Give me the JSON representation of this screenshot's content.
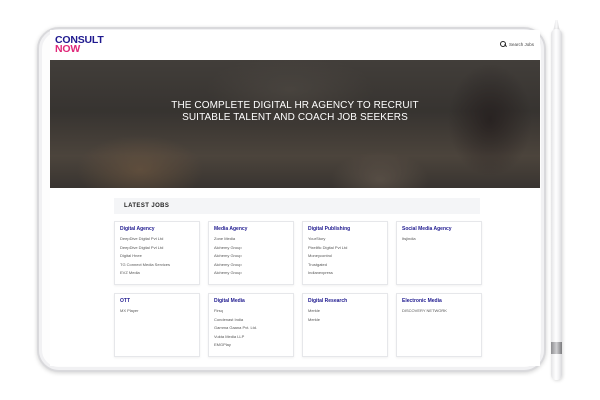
{
  "header": {
    "logo_line1": "CONSULT",
    "logo_line2": "NOW",
    "search_label": "Search Jobs"
  },
  "hero": {
    "title": "THE COMPLETE DIGITAL HR AGENCY TO RECRUIT SUITABLE TALENT AND COACH JOB SEEKERS"
  },
  "jobs": {
    "section_title": "LATEST JOBS",
    "categories": [
      {
        "title": "Digital Agency",
        "items": [
          "DeepDive Digital Pvt Ltd",
          "DeepDive Digital Pvt Ltd",
          "Digital Hnee",
          "TG Connect Media Services",
          "EVZ Media"
        ]
      },
      {
        "title": "Media Agency",
        "items": [
          "Zone Media",
          "Alchemy Group",
          "Alchemy Group",
          "Alchemy Group",
          "Alchemy Group"
        ]
      },
      {
        "title": "Digital Publishing",
        "items": [
          "YourStory",
          "Pixelific Digital Pvt Ltd",
          "Moneycontrol",
          "Trustgated",
          "Indianexpress"
        ]
      },
      {
        "title": "Social Media Agency",
        "items": [
          "Itsjindia"
        ]
      },
      {
        "title": "OTT",
        "items": [
          "MX Player"
        ]
      },
      {
        "title": "Digital Media",
        "items": [
          "Firsq",
          "Condenast India",
          "Gamma Gaana Pvt. Ltd.",
          "Vukta Media LLP",
          "EMGPlay"
        ]
      },
      {
        "title": "Digital Research",
        "items": [
          "Merkle",
          "Merkle"
        ]
      },
      {
        "title": "Electronic Media",
        "items": [
          "DISCOVERY NETWORK"
        ]
      }
    ]
  },
  "colors": {
    "brand_primary": "#1f1a8f",
    "brand_accent": "#e0287a",
    "section_bg": "#f4f5f7"
  }
}
